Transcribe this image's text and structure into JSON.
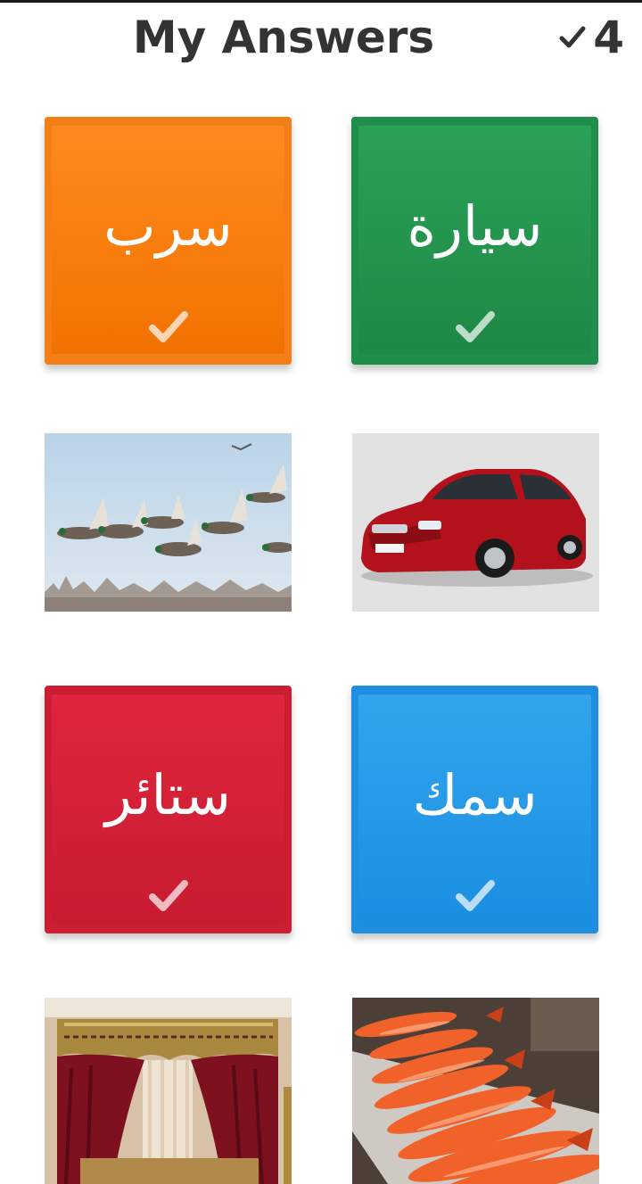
{
  "header": {
    "title": "My Answers",
    "score": "4",
    "score_icon": "checkmark-icon"
  },
  "tiles": [
    {
      "word": "سرب",
      "color": "#f57f17",
      "icon": "checkmark-icon"
    },
    {
      "word": "سيارة",
      "color": "#1f8e4a",
      "icon": "checkmark-icon"
    },
    {
      "word": "ستائر",
      "color": "#cc1e33",
      "icon": "checkmark-icon"
    },
    {
      "word": "سمك",
      "color": "#1e8fe0",
      "icon": "checkmark-icon"
    }
  ],
  "photos": [
    {
      "subject": "flock of ducks flying"
    },
    {
      "subject": "red car"
    },
    {
      "subject": "red curtains"
    },
    {
      "subject": "orange fish"
    }
  ]
}
